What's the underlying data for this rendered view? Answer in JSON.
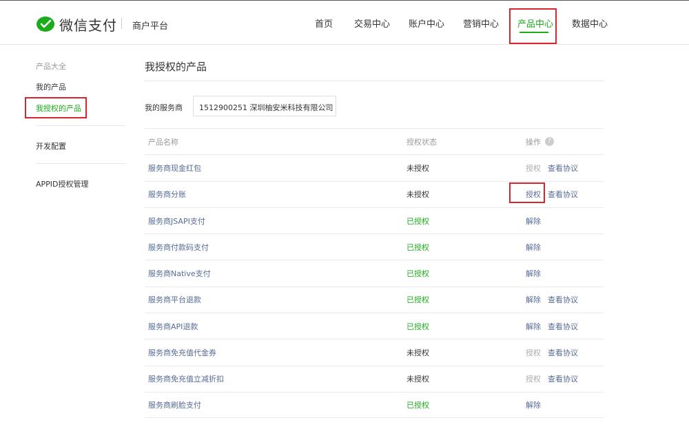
{
  "app": {
    "brand": "微信支付",
    "subtitle": "商户平台"
  },
  "nav": [
    {
      "label": "首页",
      "active": false
    },
    {
      "label": "交易中心",
      "active": false
    },
    {
      "label": "账户中心",
      "active": false
    },
    {
      "label": "营销中心",
      "active": false
    },
    {
      "label": "产品中心",
      "active": true
    },
    {
      "label": "数据中心",
      "active": false
    }
  ],
  "sidebar": {
    "group_title": "产品大全",
    "items": [
      {
        "label": "我的产品",
        "active": false
      },
      {
        "label": "我授权的产品",
        "active": true
      },
      {
        "label": "开发配置",
        "active": false
      },
      {
        "label": "APPID授权管理",
        "active": false
      }
    ]
  },
  "main": {
    "title": "我授权的产品",
    "provider_label": "我的服务商",
    "provider_value": "1512900251 深圳柚安米科技有限公司",
    "table": {
      "headers": {
        "name": "产品名称",
        "status": "授权状态",
        "op": "操作",
        "help": "?"
      },
      "rows": [
        {
          "name": "服务商现金红包",
          "status": "未授权",
          "authorized": false,
          "op1": "授权",
          "op1_enabled": false,
          "op2": "查看协议"
        },
        {
          "name": "服务商分账",
          "status": "未授权",
          "authorized": false,
          "op1": "授权",
          "op1_enabled": true,
          "op2": "查看协议"
        },
        {
          "name": "服务商JSAPI支付",
          "status": "已授权",
          "authorized": true,
          "op1": "解除",
          "op1_enabled": true,
          "op2": ""
        },
        {
          "name": "服务商付款码支付",
          "status": "已授权",
          "authorized": true,
          "op1": "解除",
          "op1_enabled": true,
          "op2": ""
        },
        {
          "name": "服务商Native支付",
          "status": "已授权",
          "authorized": true,
          "op1": "解除",
          "op1_enabled": true,
          "op2": ""
        },
        {
          "name": "服务商平台退款",
          "status": "已授权",
          "authorized": true,
          "op1": "解除",
          "op1_enabled": true,
          "op2": "查看协议"
        },
        {
          "name": "服务商API退款",
          "status": "已授权",
          "authorized": true,
          "op1": "解除",
          "op1_enabled": true,
          "op2": "查看协议"
        },
        {
          "name": "服务商免充值代金券",
          "status": "未授权",
          "authorized": false,
          "op1": "授权",
          "op1_enabled": false,
          "op2": "查看协议"
        },
        {
          "name": "服务商免充值立减折扣",
          "status": "未授权",
          "authorized": false,
          "op1": "授权",
          "op1_enabled": false,
          "op2": "查看协议"
        },
        {
          "name": "服务商刷脸支付",
          "status": "已授权",
          "authorized": true,
          "op1": "解除",
          "op1_enabled": true,
          "op2": ""
        }
      ]
    }
  },
  "colors": {
    "brand_green": "#1aad19",
    "link_blue": "#576b95",
    "highlight_red": "#d9232d"
  }
}
